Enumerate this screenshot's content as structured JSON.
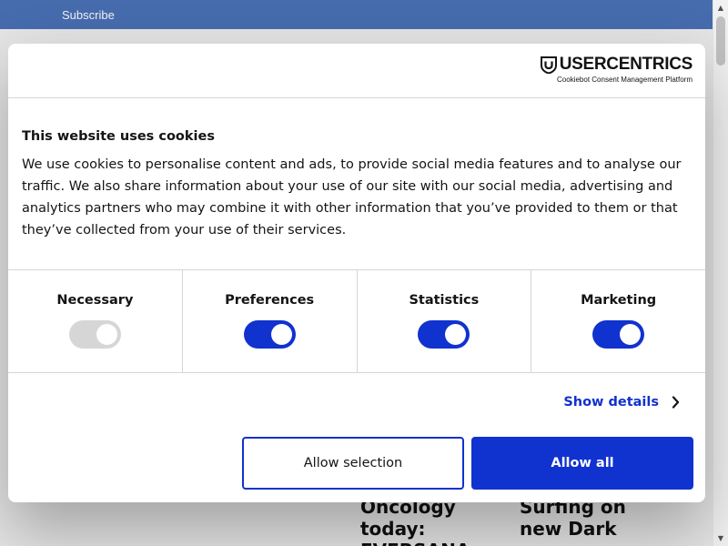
{
  "page": {
    "subscribe_label": "Subscribe",
    "articles": [
      {
        "title": "Oncology today: EVERSANA"
      },
      {
        "title": "Surfing on new Dark"
      }
    ]
  },
  "dialog": {
    "brand": {
      "name": "USERCENTRICS",
      "subtitle": "Cookiebot Consent Management Platform",
      "icon": "shield-logo-icon"
    },
    "title": "This website uses cookies",
    "description": "We use cookies to personalise content and ads, to provide social media features and to analyse our traffic. We also share information about your use of our site with our social media, advertising and analytics partners who may combine it with other information that you’ve provided to them or that they’ve collected from your use of their services.",
    "toggles": [
      {
        "label": "Necessary",
        "state": "on",
        "disabled": true
      },
      {
        "label": "Preferences",
        "state": "on",
        "disabled": false
      },
      {
        "label": "Statistics",
        "state": "on",
        "disabled": false
      },
      {
        "label": "Marketing",
        "state": "on",
        "disabled": false
      }
    ],
    "show_details_label": "Show details",
    "allow_selection_label": "Allow selection",
    "allow_all_label": "Allow all"
  },
  "colors": {
    "accent": "#1032cf",
    "top_bar": "#4a72b8",
    "toggle_disabled": "#d6d6d6"
  }
}
